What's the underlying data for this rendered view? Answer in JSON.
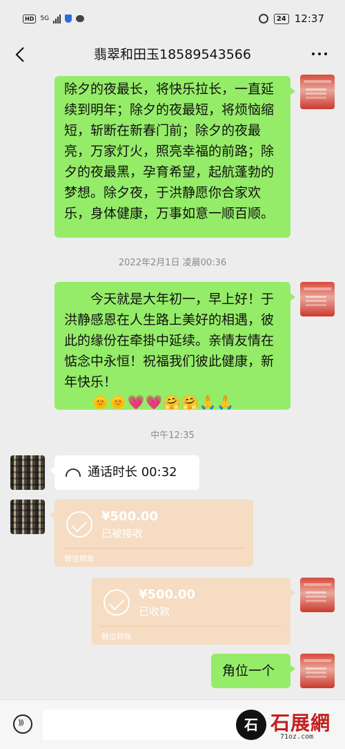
{
  "status_bar": {
    "hd": "HD",
    "network": "5G",
    "battery": "24",
    "time": "12:37"
  },
  "header": {
    "title": "翡翠和田玉18589543566"
  },
  "messages": {
    "m1": "除夕的夜最长，将快乐拉长，一直延续到明年；除夕的夜最短，将烦恼缩短，斩断在新春门前；除夕的夜最亮，万家灯火，照亮幸福的前路；除夕的夜最黑，孕育希望，起航蓬勃的梦想。除夕夜，于洪静愿你合家欢乐，身体健康，万事如意一顺百顺。",
    "ts1": "2022年2月1日 凌晨00:36",
    "m2": "今天就是大年初一，早上好！于洪静感恩在人生路上美好的相遇，彼此的缘份在牵掛中延续。亲情友情在惦念中永恒！祝福我们彼此健康，新年快乐！",
    "m2_emojis": [
      "🌞",
      "🌞",
      "💗",
      "💗",
      "🤗",
      "🤗",
      "🙏",
      "🙏"
    ],
    "ts2": "中午12:35",
    "call": "通话时长 00:32",
    "transfer1": {
      "amount": "¥500.00",
      "status": "已被接收",
      "brand": "微信转账"
    },
    "transfer2": {
      "amount": "¥500.00",
      "status": "已收款",
      "brand": "微信转账"
    },
    "m5": "角位一个"
  },
  "watermark": {
    "logo_char": "石",
    "name": "石展網",
    "site": "71oz.com"
  },
  "colors": {
    "background": "#ededed",
    "bubble_self": "#95ec69",
    "bubble_other": "#ffffff",
    "transfer": "#f5dcc2"
  }
}
